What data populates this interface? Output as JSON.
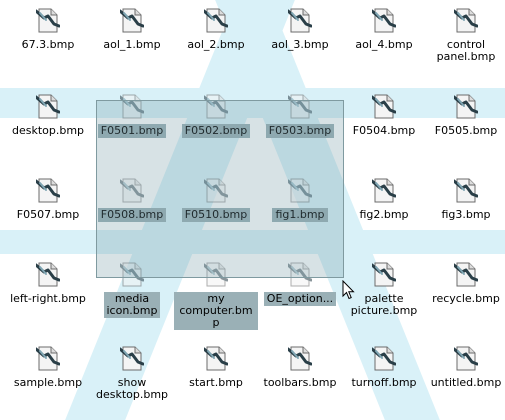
{
  "files": [
    {
      "label": "67.3.bmp",
      "selected": false
    },
    {
      "label": "aol_1.bmp",
      "selected": false
    },
    {
      "label": "aol_2.bmp",
      "selected": false
    },
    {
      "label": "aol_3.bmp",
      "selected": false
    },
    {
      "label": "aol_4.bmp",
      "selected": false
    },
    {
      "label": "control\npanel.bmp",
      "selected": false
    },
    {
      "label": "desktop.bmp",
      "selected": false
    },
    {
      "label": "F0501.bmp",
      "selected": true
    },
    {
      "label": "F0502.bmp",
      "selected": true
    },
    {
      "label": "F0503.bmp",
      "selected": true
    },
    {
      "label": "F0504.bmp",
      "selected": false
    },
    {
      "label": "F0505.bmp",
      "selected": false
    },
    {
      "label": "F0507.bmp",
      "selected": false
    },
    {
      "label": "F0508.bmp",
      "selected": true
    },
    {
      "label": "F0510.bmp",
      "selected": true
    },
    {
      "label": "fig1.bmp",
      "selected": true
    },
    {
      "label": "fig2.bmp",
      "selected": false
    },
    {
      "label": "fig3.bmp",
      "selected": false
    },
    {
      "label": "left-right.bmp",
      "selected": false
    },
    {
      "label": "media\nicon.bmp",
      "selected": true
    },
    {
      "label": "my\ncomputer.bmp",
      "selected": true
    },
    {
      "label": "OE_option...",
      "selected": true
    },
    {
      "label": "palette\npicture.bmp",
      "selected": false
    },
    {
      "label": "recycle.bmp",
      "selected": false
    },
    {
      "label": "sample.bmp",
      "selected": false
    },
    {
      "label": "show\ndesktop.bmp",
      "selected": false
    },
    {
      "label": "start.bmp",
      "selected": false
    },
    {
      "label": "toolbars.bmp",
      "selected": false
    },
    {
      "label": "turnoff.bmp",
      "selected": false
    },
    {
      "label": "untitled.bmp",
      "selected": false
    }
  ],
  "icon": "bitmap-file-icon",
  "colors": {
    "selection_label_bg": "#9ab0b6",
    "marquee_fill": "#6e96a0",
    "watermark": "#d9f1f8"
  }
}
